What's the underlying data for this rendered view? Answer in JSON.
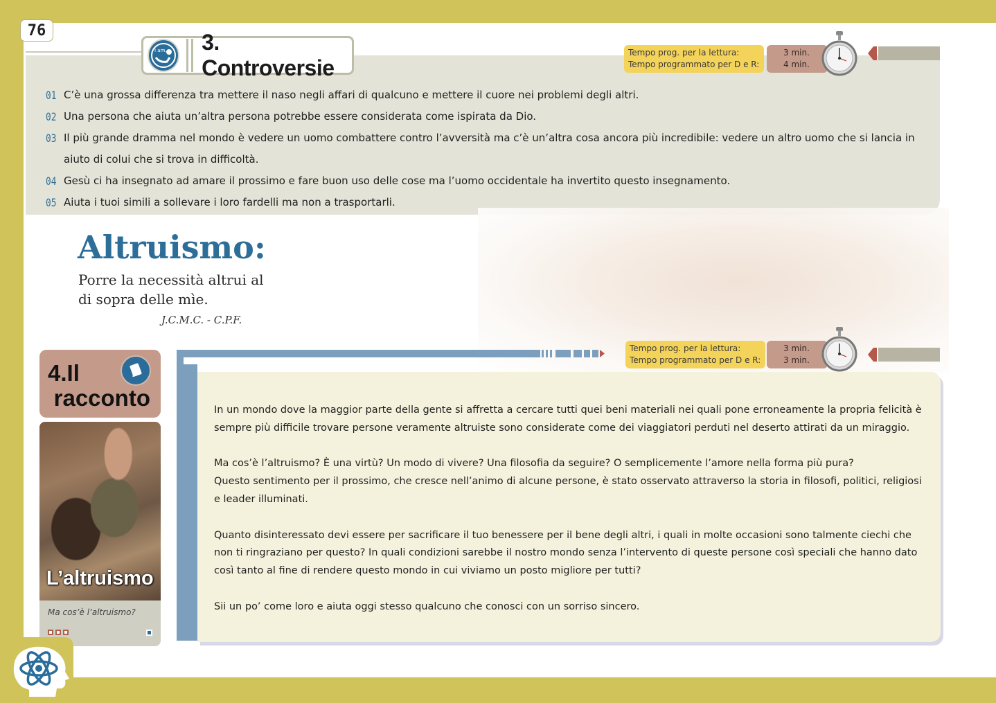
{
  "page": {
    "number": "76"
  },
  "controversie": {
    "title": "3. Controversie",
    "logo_text": "I am...",
    "timer": {
      "line1_label": "Tempo prog. per la lettura:",
      "line2_label": "Tempo programmato per D e R:",
      "line1_value": "3 min.",
      "line2_value": "4 min."
    },
    "items": [
      {
        "num": "01",
        "text": "C’è una grossa differenza tra mettere il naso negli affari di qualcuno e mettere il cuore nei problemi degli altri."
      },
      {
        "num": "02",
        "text": "Una persona che aiuta un’altra persona potrebbe essere considerata come ispirata da Dio."
      },
      {
        "num": "03",
        "text": "Il più grande dramma nel mondo è vedere un uomo combattere contro l’avversità ma c’è un’altra cosa ancora  più incredibile: vedere un altro uomo che si lancia in aiuto di colui che si trova in difficoltà."
      },
      {
        "num": "04",
        "text": "Gesù ci ha insegnato ad amare il prossimo e fare buon uso delle cose ma l’uomo occidentale ha invertito questo insegnamento."
      },
      {
        "num": "05",
        "text": "Aiuta i tuoi simili a sollevare i loro fardelli ma non a trasportarli."
      }
    ]
  },
  "altruismo": {
    "title": "Altruismo:",
    "definition": "Porre la necessità altrui al di sopra delle mìe.",
    "author": "J.C.M.C. - C.P.F."
  },
  "racconto": {
    "title_line1": "4.Il",
    "title_line2": "racconto",
    "photo_caption": "L’altruismo",
    "photo_subtitle": "Ma cos’è l’altruismo?",
    "timer": {
      "line1_label": "Tempo prog. per la lettura:",
      "line2_label": "Tempo programmato per D e R:",
      "line1_value": "3 min.",
      "line2_value": "3 min."
    },
    "paragraphs": [
      "In un mondo dove la maggior parte della gente si affretta a cercare tutti quei beni materiali nei quali pone erroneamente la propria felicità è sempre più difficile trovare persone veramente altruiste sono considerate come dei viaggiatori perduti nel deserto attirati da un miraggio.",
      "Ma cos’è l’altruismo? È una virtù? Un modo di vivere? Una filosofia da seguire? O semplicemente l’amore nella forma più pura?",
      "Questo sentimento per il prossimo, che cresce nell’animo di alcune persone, è stato osservato attraverso la storia in filosofi, politici, religiosi e leader illuminati.",
      "Quanto disinteressato devi essere per sacrificare il tuo benessere per il bene degli altri, i quali in molte occasioni sono talmente ciechi che non ti ringraziano per questo? In quali condizioni sarebbe il nostro mondo senza l’intervento di queste persone così speciali che hanno dato così  tanto al fine di rendere questo mondo in cui viviamo un posto migliore per tutti?",
      "Sii un po’ come loro e aiuta oggi stesso qualcuno che conosci con un sorriso sincero."
    ]
  },
  "colors": {
    "border": "#cfc35a",
    "accent_blue": "#2c6e98",
    "panel_grey": "#e3e3d8",
    "story_bg": "#f4f2dc",
    "timer_yellow": "#f4d35a",
    "timer_rose": "#c49a8a"
  },
  "icons": [
    "iam-logo-icon",
    "stopwatch-icon",
    "book-icon",
    "atom-brain-icon"
  ]
}
